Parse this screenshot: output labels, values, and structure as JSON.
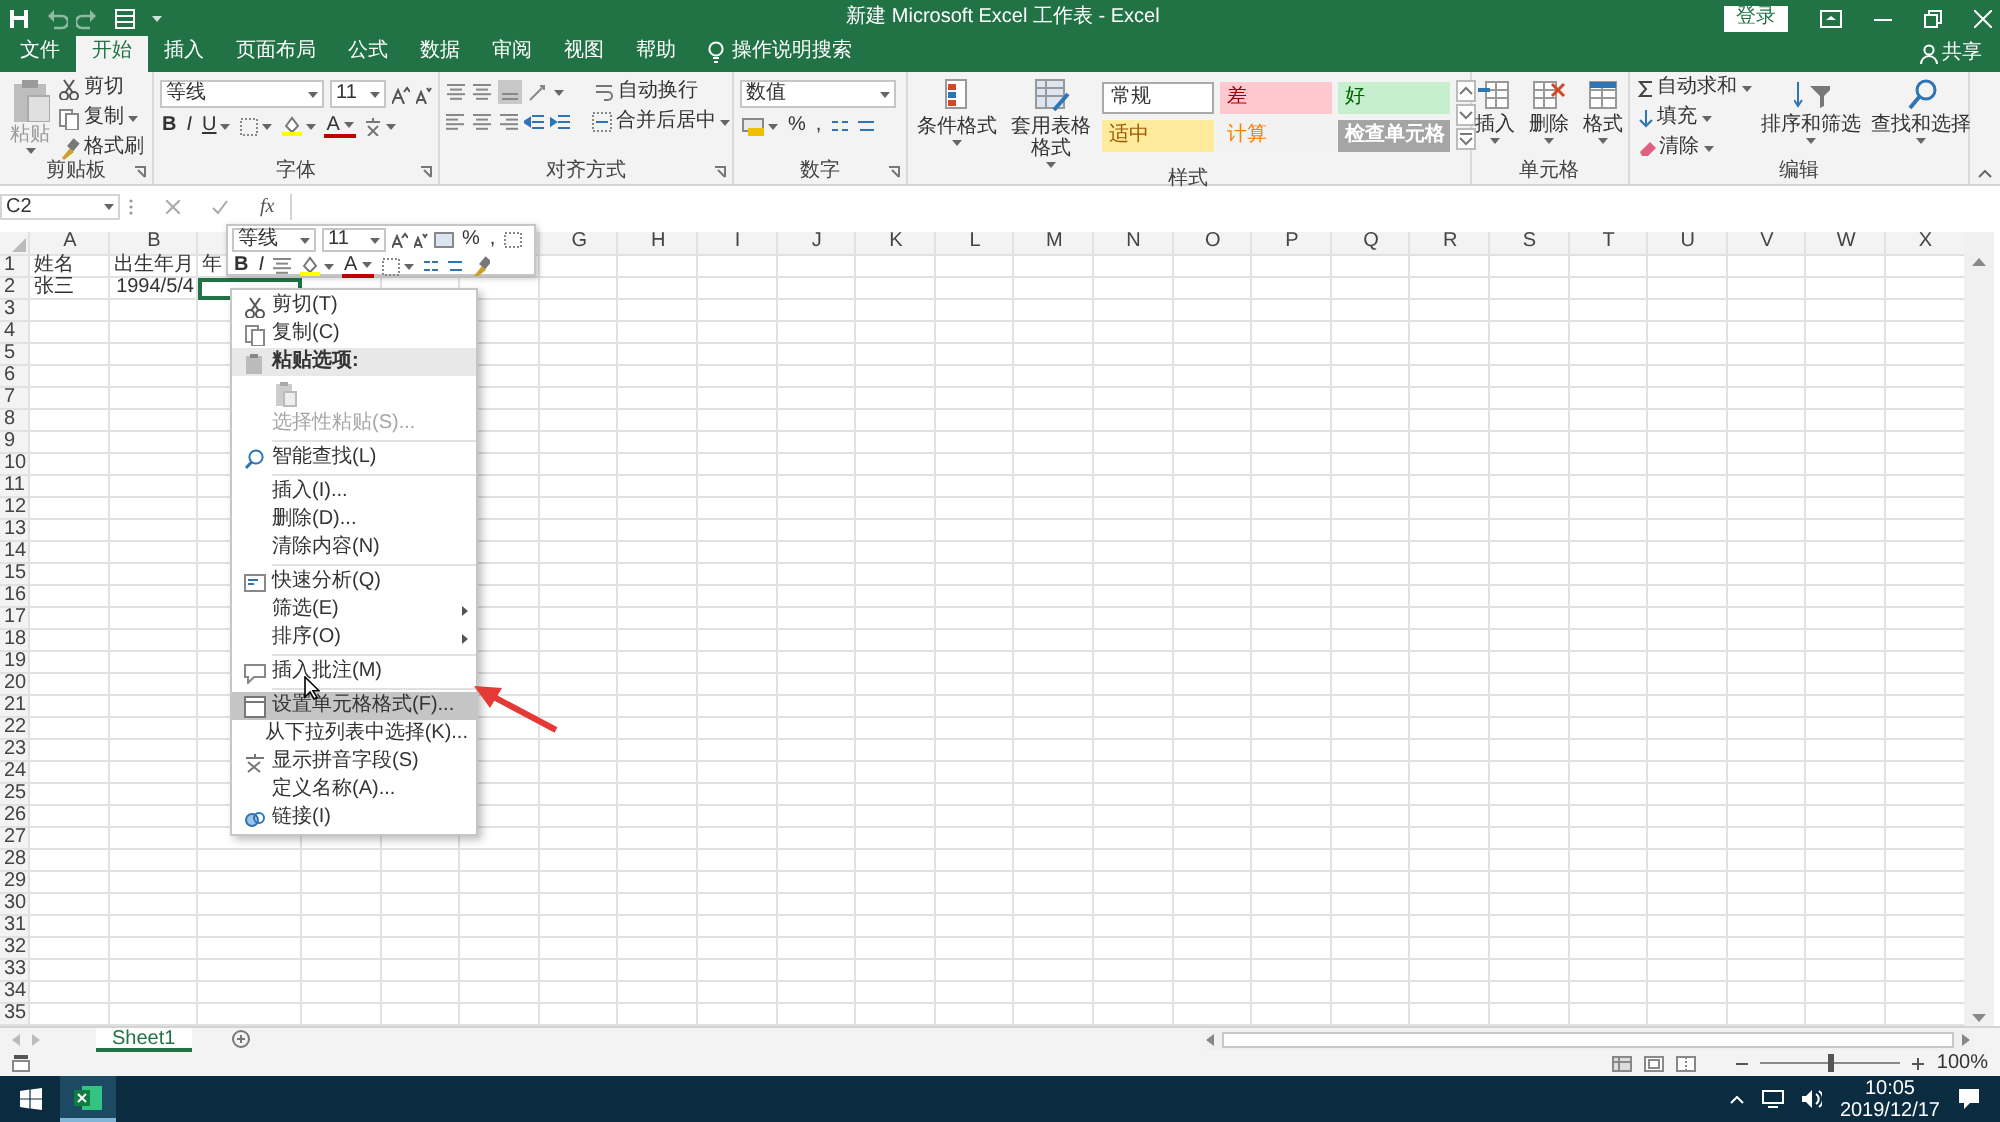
{
  "window": {
    "title": "新建 Microsoft Excel 工作表  -  Excel",
    "sign_in": "登录"
  },
  "menu_tabs": [
    {
      "label": "文件",
      "selected": false
    },
    {
      "label": "开始",
      "selected": true
    },
    {
      "label": "插入",
      "selected": false
    },
    {
      "label": "页面布局",
      "selected": false
    },
    {
      "label": "公式",
      "selected": false
    },
    {
      "label": "数据",
      "selected": false
    },
    {
      "label": "审阅",
      "selected": false
    },
    {
      "label": "视图",
      "selected": false
    },
    {
      "label": "帮助",
      "selected": false
    }
  ],
  "tell_me": "操作说明搜索",
  "share": "共享",
  "ribbon": {
    "clipboard": {
      "label": "剪贴板",
      "paste": "粘贴",
      "cut": "剪切",
      "copy": "复制",
      "format_painter": "格式刷"
    },
    "font": {
      "label": "字体",
      "font_name": "等线",
      "font_size": "11",
      "bold": "B",
      "italic": "I",
      "underline": "U",
      "font_color": "A"
    },
    "alignment": {
      "label": "对齐方式",
      "wrap_text": "自动换行",
      "merge_center": "合并后居中"
    },
    "number": {
      "label": "数字",
      "format": "数值",
      "percent": "%",
      "comma": ","
    },
    "styles": {
      "label": "样式",
      "conditional": "条件格式",
      "table_format": "套用表格格式",
      "cell_styles": [
        {
          "label": "常规",
          "color": "#ffffff"
        },
        {
          "label": "差",
          "color": "#ffc7ce"
        },
        {
          "label": "好",
          "color": "#c6efce"
        },
        {
          "label": "适中",
          "color": "#ffeb9c"
        },
        {
          "label": "计算",
          "color": "#f2f2f2"
        },
        {
          "label": "检查单元格",
          "color": "#a5a5a5"
        }
      ]
    },
    "cells": {
      "label": "单元格",
      "buttons": [
        "插入",
        "删除",
        "格式"
      ]
    },
    "editing": {
      "label": "编辑",
      "autosum": "自动求和",
      "fill": "填充",
      "clear": "清除",
      "sort_filter": "排序和筛选",
      "find_select": "查找和选择"
    }
  },
  "formula_bar": {
    "name_box": "C2",
    "function_label": "fx"
  },
  "sheet": {
    "columns_left": [
      "A",
      "B"
    ],
    "columns_right": [
      "G",
      "H",
      "I",
      "J",
      "K",
      "L",
      "M",
      "N",
      "O",
      "P",
      "Q",
      "R",
      "S",
      "T",
      "U",
      "V",
      "W",
      "X"
    ],
    "rows": [
      {
        "number": "1",
        "cells": [
          {
            "kind": "text",
            "text": "姓名",
            "selected": false
          },
          {
            "kind": "text",
            "text": "出生年月",
            "selected": false
          },
          {
            "kind": "text",
            "text": "年",
            "selected": false
          }
        ]
      },
      {
        "number": "2",
        "cells": [
          {
            "kind": "text",
            "text": "张三",
            "selected": false
          },
          {
            "kind": "date",
            "text": "1994/5/4",
            "selected": false
          },
          {
            "kind": "text",
            "selected": true
          }
        ]
      },
      {
        "number": "3"
      },
      {
        "number": "4"
      },
      {
        "number": "5"
      },
      {
        "number": "6"
      },
      {
        "number": "7"
      },
      {
        "number": "8"
      },
      {
        "number": "9"
      },
      {
        "number": "10"
      },
      {
        "number": "11"
      },
      {
        "number": "12"
      },
      {
        "number": "13"
      },
      {
        "number": "14"
      },
      {
        "number": "15"
      },
      {
        "number": "16"
      },
      {
        "number": "17"
      },
      {
        "number": "18"
      },
      {
        "number": "19"
      },
      {
        "number": "20"
      },
      {
        "number": "21"
      },
      {
        "number": "22"
      },
      {
        "number": "23"
      },
      {
        "number": "24"
      },
      {
        "number": "25"
      },
      {
        "number": "26"
      },
      {
        "number": "27"
      },
      {
        "number": "28"
      },
      {
        "number": "29"
      },
      {
        "number": "30"
      },
      {
        "number": "31"
      },
      {
        "number": "32"
      },
      {
        "number": "33"
      },
      {
        "number": "34"
      },
      {
        "number": "35"
      }
    ]
  },
  "mini_toolbar": {
    "font_name": "等线",
    "font_size": "11",
    "percent": "%",
    "comma": ",",
    "bold": "B",
    "italic": "I",
    "font_color": "A"
  },
  "context_menu": [
    {
      "kind": "item",
      "label": "剪切(T)",
      "disabled": false,
      "selected": false,
      "submenu": false
    },
    {
      "kind": "item",
      "label": "复制(C)",
      "disabled": false,
      "selected": false,
      "submenu": false
    },
    {
      "kind": "header",
      "label": "粘贴选项:"
    },
    {
      "kind": "paste_options"
    },
    {
      "kind": "item",
      "label": "选择性粘贴(S)...",
      "disabled": true,
      "selected": false,
      "submenu": false
    },
    {
      "kind": "separator"
    },
    {
      "kind": "item",
      "label": "智能查找(L)",
      "disabled": false,
      "selected": false,
      "submenu": false
    },
    {
      "kind": "separator"
    },
    {
      "kind": "item",
      "label": "插入(I)...",
      "disabled": false,
      "selected": false,
      "submenu": false
    },
    {
      "kind": "item",
      "label": "删除(D)...",
      "disabled": false,
      "selected": false,
      "submenu": false
    },
    {
      "kind": "item",
      "label": "清除内容(N)",
      "disabled": false,
      "selected": false,
      "submenu": false
    },
    {
      "kind": "separator"
    },
    {
      "kind": "item",
      "label": "快速分析(Q)",
      "disabled": false,
      "selected": false,
      "submenu": false
    },
    {
      "kind": "item",
      "label": "筛选(E)",
      "disabled": false,
      "selected": false,
      "submenu": true
    },
    {
      "kind": "item",
      "label": "排序(O)",
      "disabled": false,
      "selected": false,
      "submenu": true
    },
    {
      "kind": "separator"
    },
    {
      "kind": "item",
      "label": "插入批注(M)",
      "disabled": false,
      "selected": false,
      "submenu": false
    },
    {
      "kind": "separator"
    },
    {
      "kind": "item",
      "label": "设置单元格格式(F)...",
      "disabled": false,
      "selected": true,
      "submenu": false
    },
    {
      "kind": "item",
      "label": "从下拉列表中选择(K)...",
      "disabled": false,
      "selected": false,
      "submenu": false
    },
    {
      "kind": "item",
      "label": "显示拼音字段(S)",
      "disabled": false,
      "selected": false,
      "submenu": false
    },
    {
      "kind": "item",
      "label": "定义名称(A)...",
      "disabled": false,
      "selected": false,
      "submenu": false
    },
    {
      "kind": "item",
      "label": "链接(I)",
      "disabled": false,
      "selected": false,
      "submenu": false
    }
  ],
  "sheet_tabs": [
    {
      "label": "Sheet1",
      "selected": true
    }
  ],
  "status_bar": {
    "zoom": "100%",
    "zoom_slider": {
      "level": 0.5
    }
  },
  "taskbar": {
    "time": "10:05",
    "date": "2019/12/17"
  }
}
